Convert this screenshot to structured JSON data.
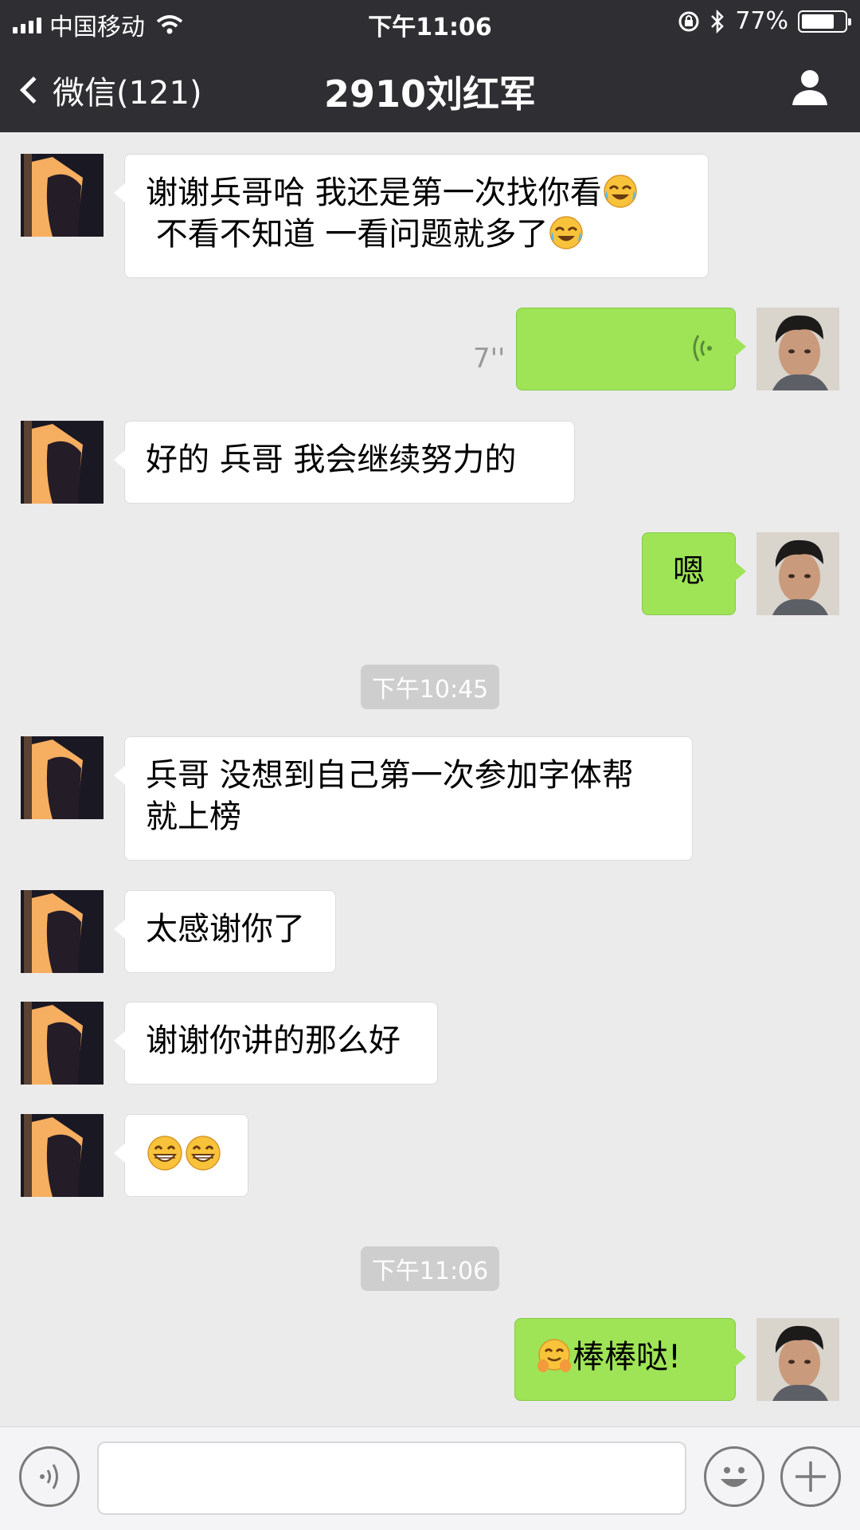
{
  "status_bar": {
    "carrier": "中国移动",
    "time": "下午11:06",
    "battery": "77%",
    "battery_level": 0.77
  },
  "nav": {
    "back_label": "微信(121)",
    "title": "2910刘红军"
  },
  "messages": [
    {
      "from": "friend",
      "lines": [
        "谢谢兵哥哈 我还是第一次找你看",
        "不看不知道 一看问题就多了"
      ],
      "emojis": [
        "face-tears-icon",
        "face-tears-icon"
      ]
    },
    {
      "from": "me",
      "type": "voice",
      "duration": "7''"
    },
    {
      "from": "friend",
      "text": "好的 兵哥 我会继续努力的"
    },
    {
      "from": "me",
      "text": "嗯"
    },
    {
      "type": "time",
      "text": "下午10:45"
    },
    {
      "from": "friend",
      "lines": [
        "兵哥 没想到自己第一次参加字体帮",
        "就上榜"
      ]
    },
    {
      "from": "friend",
      "text": "太感谢你了"
    },
    {
      "from": "friend",
      "text": "谢谢你讲的那么好"
    },
    {
      "from": "friend",
      "emojis": [
        "grin-icon",
        "grin-icon"
      ]
    },
    {
      "type": "time",
      "text": "下午11:06"
    },
    {
      "from": "me",
      "text": "棒棒哒!",
      "emojis": [
        "hug-face-icon"
      ]
    }
  ],
  "input_bar": {
    "value": "",
    "placeholder": ""
  },
  "colors": {
    "nav_bg": "#2e2e33",
    "chat_bg": "#ebebeb",
    "bubble_out": "#9ee456",
    "bubble_in": "#ffffff"
  }
}
